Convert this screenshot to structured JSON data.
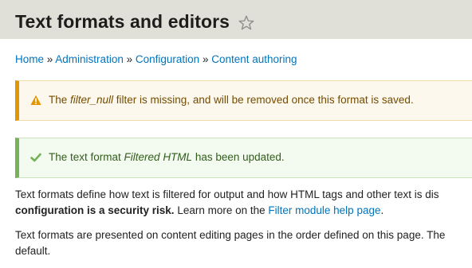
{
  "header": {
    "title": "Text formats and editors",
    "shortcut_icon": "star-icon"
  },
  "breadcrumb": {
    "items": [
      "Home",
      "Administration",
      "Configuration",
      "Content authoring"
    ],
    "separator": "»"
  },
  "messages": {
    "warning": {
      "icon": "warning-icon",
      "text_before": "The ",
      "filter_name": "filter_null",
      "text_after": " filter is missing, and will be removed once this format is saved."
    },
    "status": {
      "icon": "check-icon",
      "text_before": "The text format ",
      "format_name": "Filtered HTML",
      "text_after": " has been updated."
    }
  },
  "description": {
    "p1_line1": "Text formats define how text is filtered for output and how HTML tags and other text is dis",
    "p1_bold": "configuration is a security risk.",
    "p1_text": " Learn more on the ",
    "p1_link": "Filter module help page",
    "p1_end": ".",
    "p2_line1": "Text formats are presented on content editing pages in the order defined on this page. The",
    "p2_line2": "default."
  },
  "colors": {
    "link": "#0074bd",
    "header_bg": "#e0e0d8",
    "warning_border": "#e09600",
    "status_border": "#77b259"
  }
}
